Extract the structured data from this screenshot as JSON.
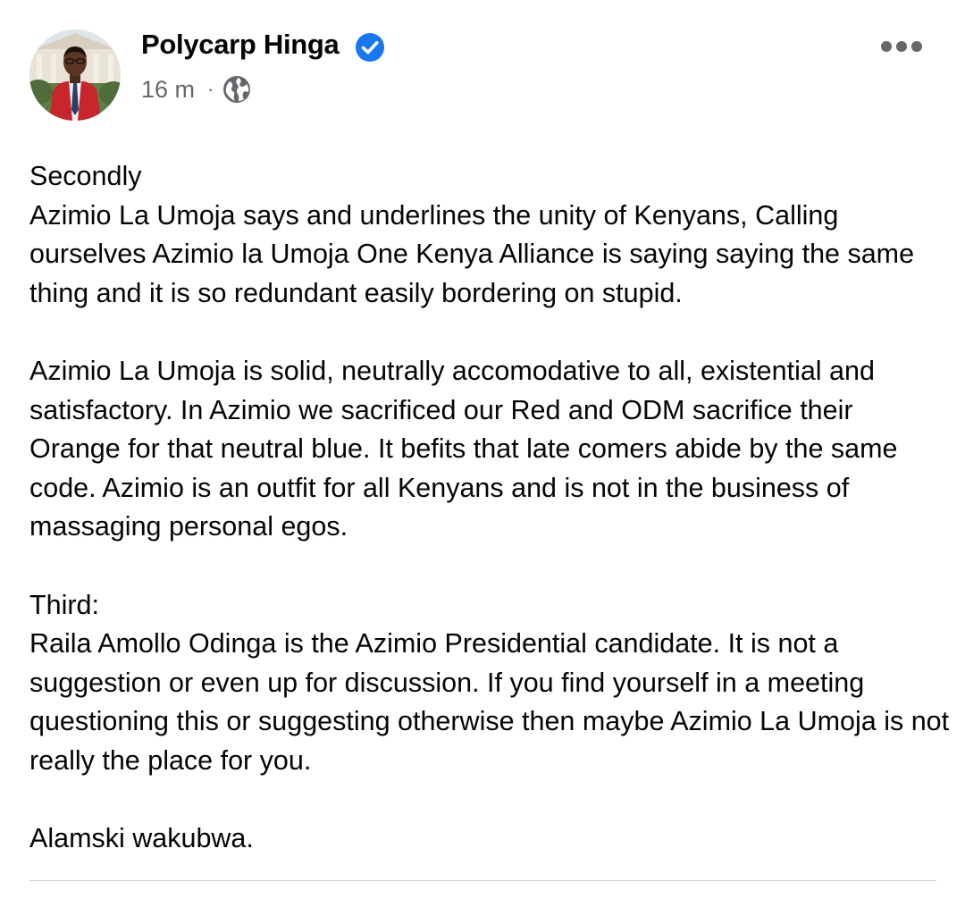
{
  "post": {
    "author": {
      "name": "Polycarp Hinga",
      "verified": true,
      "avatar_icon": "profile-photo"
    },
    "timestamp": "16 m",
    "separator": "·",
    "audience_icon": "globe-icon",
    "more_icon": "more-options-icon",
    "body": "Secondly\nAzimio La Umoja says and underlines the unity of Kenyans,   Calling ourselves Azimio la Umoja One Kenya Alliance is saying saying the same thing and it is so redundant easily bordering on stupid.\n\nAzimio La Umoja is solid, neutrally accomodative to all, existential and satisfactory. In Azimio we sacrificed our Red and ODM sacrifice their Orange for that neutral blue. It befits that late comers abide by the same code.  Azimio is an outfit for all Kenyans and is not in the business of massaging personal egos.\n\nThird:\nRaila Amollo Odinga is the Azimio Presidential candidate. It is not a suggestion or even up for discussion. If you find yourself in a meeting questioning this or suggesting otherwise then maybe Azimio La Umoja is not really the place for you.\n\nAlamski wakubwa."
  },
  "colors": {
    "verified_badge": "#1877f2",
    "secondary_text": "#65676b",
    "primary_text": "#050505",
    "divider": "#ced0d4"
  }
}
